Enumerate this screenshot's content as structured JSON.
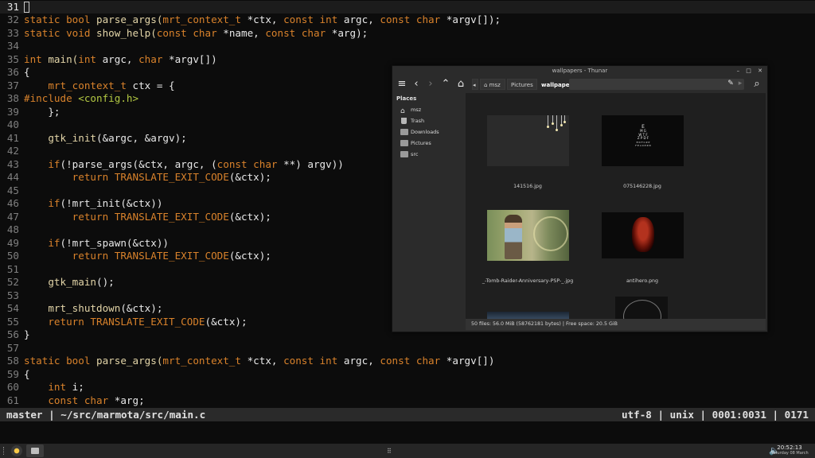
{
  "editor": {
    "current_line": "31",
    "lines": [
      {
        "n": "31",
        "segs": []
      },
      {
        "n": "32",
        "segs": [
          {
            "t": "static bool ",
            "c": "kw"
          },
          {
            "t": "parse_args(",
            "c": "fn"
          },
          {
            "t": "mrt_context_t",
            "c": "ty"
          },
          {
            "t": " *ctx, ",
            "c": "plain"
          },
          {
            "t": "const int",
            "c": "kw"
          },
          {
            "t": " argc, ",
            "c": "plain"
          },
          {
            "t": "const char",
            "c": "kw"
          },
          {
            "t": " *argv[]);",
            "c": "plain"
          }
        ]
      },
      {
        "n": "33",
        "segs": [
          {
            "t": "static void ",
            "c": "kw"
          },
          {
            "t": "show_help(",
            "c": "fn"
          },
          {
            "t": "const char",
            "c": "kw"
          },
          {
            "t": " *name, ",
            "c": "plain"
          },
          {
            "t": "const char",
            "c": "kw"
          },
          {
            "t": " *arg);",
            "c": "plain"
          }
        ]
      },
      {
        "n": "34",
        "segs": []
      },
      {
        "n": "35",
        "segs": [
          {
            "t": "int ",
            "c": "kw"
          },
          {
            "t": "main(",
            "c": "fn"
          },
          {
            "t": "int",
            "c": "kw"
          },
          {
            "t": " argc, ",
            "c": "plain"
          },
          {
            "t": "char",
            "c": "kw"
          },
          {
            "t": " *argv[])",
            "c": "plain"
          }
        ]
      },
      {
        "n": "36",
        "segs": [
          {
            "t": "{",
            "c": "plain"
          }
        ]
      },
      {
        "n": "37",
        "segs": [
          {
            "t": "    ",
            "c": "plain"
          },
          {
            "t": "mrt_context_t",
            "c": "ty"
          },
          {
            "t": " ctx = {",
            "c": "plain"
          }
        ]
      },
      {
        "n": "38",
        "segs": [
          {
            "t": "#include ",
            "c": "pp"
          },
          {
            "t": "<config.h>",
            "c": "inc"
          }
        ]
      },
      {
        "n": "39",
        "segs": [
          {
            "t": "    };",
            "c": "plain"
          }
        ]
      },
      {
        "n": "40",
        "segs": []
      },
      {
        "n": "41",
        "segs": [
          {
            "t": "    ",
            "c": "plain"
          },
          {
            "t": "gtk_init",
            "c": "fn"
          },
          {
            "t": "(&argc, &argv);",
            "c": "plain"
          }
        ]
      },
      {
        "n": "42",
        "segs": []
      },
      {
        "n": "43",
        "segs": [
          {
            "t": "    ",
            "c": "plain"
          },
          {
            "t": "if",
            "c": "kw"
          },
          {
            "t": "(!parse_args(&ctx, argc, (",
            "c": "plain"
          },
          {
            "t": "const char",
            "c": "kw"
          },
          {
            "t": " **) argv))",
            "c": "plain"
          }
        ]
      },
      {
        "n": "44",
        "segs": [
          {
            "t": "        ",
            "c": "plain"
          },
          {
            "t": "return ",
            "c": "kw"
          },
          {
            "t": "TRANSLATE_EXIT_CODE",
            "c": "mac"
          },
          {
            "t": "(&ctx);",
            "c": "plain"
          }
        ]
      },
      {
        "n": "45",
        "segs": []
      },
      {
        "n": "46",
        "segs": [
          {
            "t": "    ",
            "c": "plain"
          },
          {
            "t": "if",
            "c": "kw"
          },
          {
            "t": "(!mrt_init(&ctx))",
            "c": "plain"
          }
        ]
      },
      {
        "n": "47",
        "segs": [
          {
            "t": "        ",
            "c": "plain"
          },
          {
            "t": "return ",
            "c": "kw"
          },
          {
            "t": "TRANSLATE_EXIT_CODE",
            "c": "mac"
          },
          {
            "t": "(&ctx);",
            "c": "plain"
          }
        ]
      },
      {
        "n": "48",
        "segs": []
      },
      {
        "n": "49",
        "segs": [
          {
            "t": "    ",
            "c": "plain"
          },
          {
            "t": "if",
            "c": "kw"
          },
          {
            "t": "(!mrt_spawn(&ctx))",
            "c": "plain"
          }
        ]
      },
      {
        "n": "50",
        "segs": [
          {
            "t": "        ",
            "c": "plain"
          },
          {
            "t": "return ",
            "c": "kw"
          },
          {
            "t": "TRANSLATE_EXIT_CODE",
            "c": "mac"
          },
          {
            "t": "(&ctx);",
            "c": "plain"
          }
        ]
      },
      {
        "n": "51",
        "segs": []
      },
      {
        "n": "52",
        "segs": [
          {
            "t": "    ",
            "c": "plain"
          },
          {
            "t": "gtk_main",
            "c": "fn"
          },
          {
            "t": "();",
            "c": "plain"
          }
        ]
      },
      {
        "n": "53",
        "segs": []
      },
      {
        "n": "54",
        "segs": [
          {
            "t": "    ",
            "c": "plain"
          },
          {
            "t": "mrt_shutdown",
            "c": "fn"
          },
          {
            "t": "(&ctx);",
            "c": "plain"
          }
        ]
      },
      {
        "n": "55",
        "segs": [
          {
            "t": "    ",
            "c": "plain"
          },
          {
            "t": "return ",
            "c": "kw"
          },
          {
            "t": "TRANSLATE_EXIT_CODE",
            "c": "mac"
          },
          {
            "t": "(&ctx);",
            "c": "plain"
          }
        ]
      },
      {
        "n": "56",
        "segs": [
          {
            "t": "}",
            "c": "plain"
          }
        ]
      },
      {
        "n": "57",
        "segs": []
      },
      {
        "n": "58",
        "segs": [
          {
            "t": "static bool ",
            "c": "kw"
          },
          {
            "t": "parse_args(",
            "c": "fn"
          },
          {
            "t": "mrt_context_t",
            "c": "ty"
          },
          {
            "t": " *ctx, ",
            "c": "plain"
          },
          {
            "t": "const int",
            "c": "kw"
          },
          {
            "t": " argc, ",
            "c": "plain"
          },
          {
            "t": "const char",
            "c": "kw"
          },
          {
            "t": " *argv[])",
            "c": "plain"
          }
        ]
      },
      {
        "n": "59",
        "segs": [
          {
            "t": "{",
            "c": "plain"
          }
        ]
      },
      {
        "n": "60",
        "segs": [
          {
            "t": "    ",
            "c": "plain"
          },
          {
            "t": "int",
            "c": "kw"
          },
          {
            "t": " i;",
            "c": "plain"
          }
        ]
      },
      {
        "n": "61",
        "segs": [
          {
            "t": "    ",
            "c": "plain"
          },
          {
            "t": "const char",
            "c": "kw"
          },
          {
            "t": " *arg;",
            "c": "plain"
          }
        ]
      }
    ]
  },
  "statusline": {
    "left": "master | ~/src/marmota/src/main.c",
    "right": "utf-8 | unix | 0001:0031 | 0171"
  },
  "thunar": {
    "title": "wallpapers - Thunar",
    "window_buttons": "– □ ✕",
    "crumbs": [
      "msz",
      "Pictures",
      "wallpapers"
    ],
    "sidebar_title": "Places",
    "places": [
      {
        "label": "msz",
        "icon": "home-icon"
      },
      {
        "label": "Trash",
        "icon": "trash-icon"
      },
      {
        "label": "Downloads",
        "icon": "folder-icon"
      },
      {
        "label": "Pictures",
        "icon": "folder-icon"
      },
      {
        "label": "src",
        "icon": "folder-icon"
      }
    ],
    "files": [
      {
        "name": "141516.jpg"
      },
      {
        "name": "075146228.jpg"
      },
      {
        "name": "_-Tomb-Raider-Anniversary-PSP-_.jpg"
      },
      {
        "name": "antihero.png"
      }
    ],
    "status": "50 files: 56.0 MiB (58762181 bytes)  |  Free space: 20.5 GiB",
    "eye_chart": [
      "E",
      "M G",
      "W T F",
      "Z P D F",
      "E D F C Z P",
      "F E L O P Z D"
    ]
  },
  "taskbar": {
    "time": "20:52:13",
    "date": "Saturday 08 March"
  },
  "colors": {
    "keyword": "#d9822b",
    "function": "#e3d5a8",
    "include": "#b3c943",
    "statusline_bg": "#2a2a2a"
  }
}
